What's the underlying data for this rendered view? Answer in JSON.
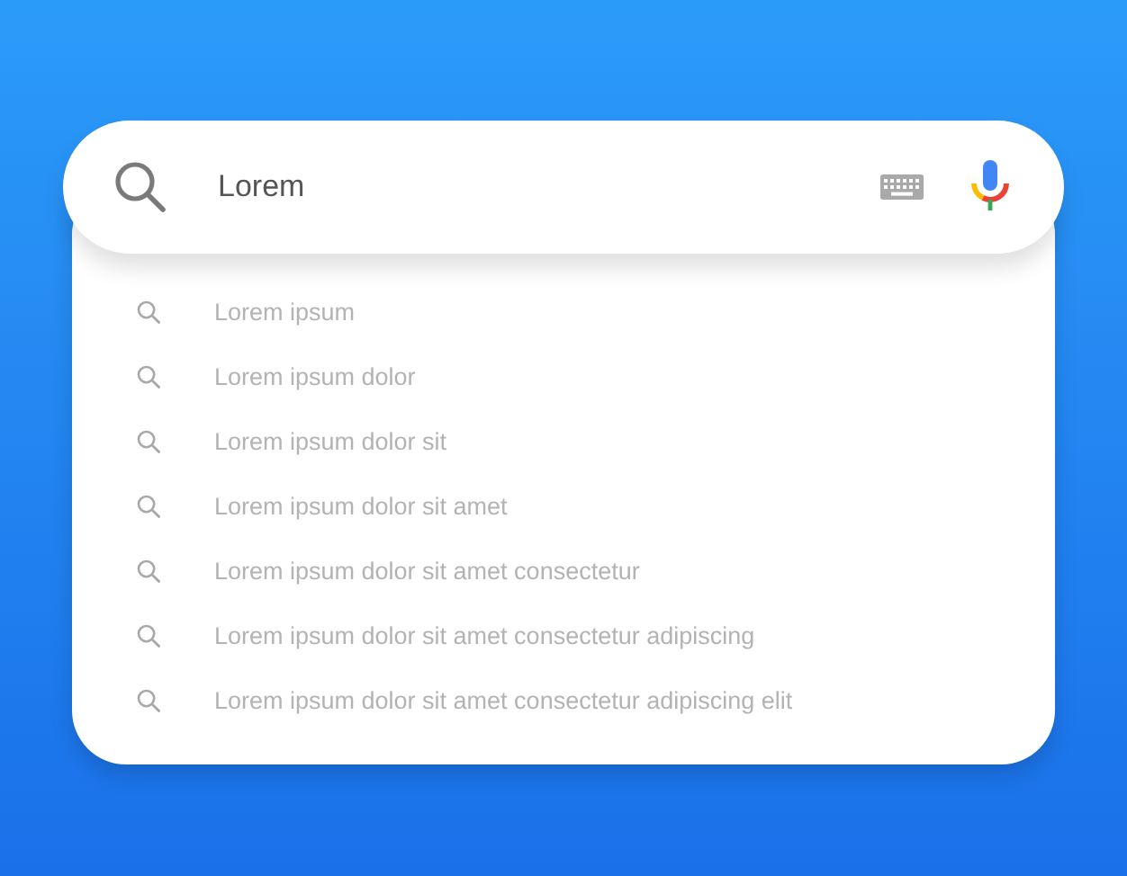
{
  "search": {
    "value": "Lorem"
  },
  "suggestions": [
    {
      "text": "Lorem ipsum"
    },
    {
      "text": "Lorem ipsum dolor"
    },
    {
      "text": "Lorem ipsum dolor sit"
    },
    {
      "text": "Lorem ipsum dolor sit amet"
    },
    {
      "text": "Lorem ipsum dolor sit amet consectetur"
    },
    {
      "text": "Lorem ipsum dolor sit amet consectetur adipiscing"
    },
    {
      "text": "Lorem ipsum dolor sit amet consectetur adipiscing elit"
    }
  ]
}
